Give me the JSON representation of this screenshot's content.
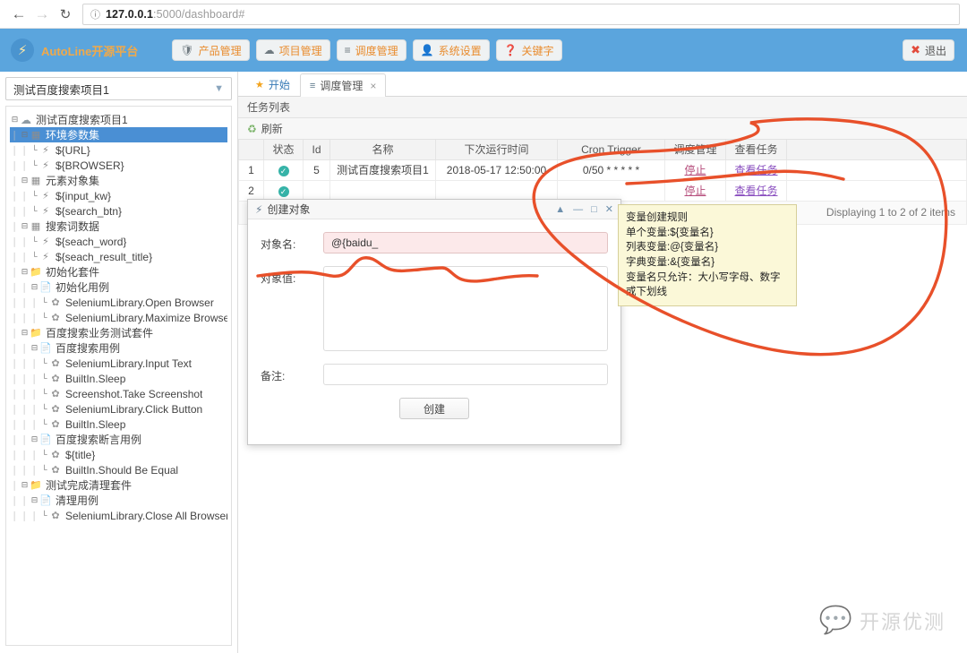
{
  "browser": {
    "back_icon": "back-arrow",
    "forward_icon": "forward-arrow",
    "reload_icon": "reload",
    "info_icon": "ⓘ",
    "url_host": "127.0.0.1",
    "url_rest": ":5000/dashboard#"
  },
  "header": {
    "brand": "AutoLine开源平台",
    "brand_color": "#f0a94a",
    "bg_color": "#5ba5dd",
    "nav": [
      {
        "label": "产品管理",
        "icon": "shield-icon"
      },
      {
        "label": "项目管理",
        "icon": "cloud-icon"
      },
      {
        "label": "调度管理",
        "icon": "list-icon"
      },
      {
        "label": "系统设置",
        "icon": "user-icon"
      },
      {
        "label": "关键字",
        "icon": "help-icon"
      }
    ],
    "logout": "退出"
  },
  "sidebar": {
    "project_selected": "测试百度搜索项目1",
    "tree": [
      {
        "depth": 0,
        "label": "测试百度搜索项目1",
        "icon": "cloud-icon",
        "expander": "minus",
        "selected": false
      },
      {
        "depth": 1,
        "label": "环境参数集",
        "icon": "folder-params-icon",
        "expander": "minus",
        "selected": true
      },
      {
        "depth": 2,
        "label": "${URL}",
        "icon": "bolt-icon",
        "expander": "leaf",
        "selected": false
      },
      {
        "depth": 2,
        "label": "${BROWSER}",
        "icon": "bolt-icon",
        "expander": "leaf",
        "selected": false
      },
      {
        "depth": 1,
        "label": "元素对象集",
        "icon": "folder-params-icon",
        "expander": "minus",
        "selected": false
      },
      {
        "depth": 2,
        "label": "${input_kw}",
        "icon": "bolt-icon",
        "expander": "leaf",
        "selected": false
      },
      {
        "depth": 2,
        "label": "${search_btn}",
        "icon": "bolt-icon",
        "expander": "leaf",
        "selected": false
      },
      {
        "depth": 1,
        "label": "搜索词数据",
        "icon": "folder-params-icon",
        "expander": "minus",
        "selected": false
      },
      {
        "depth": 2,
        "label": "${seach_word}",
        "icon": "bolt-icon",
        "expander": "leaf",
        "selected": false
      },
      {
        "depth": 2,
        "label": "${seach_result_title}",
        "icon": "bolt-icon",
        "expander": "leaf",
        "selected": false
      },
      {
        "depth": 1,
        "label": "初始化套件",
        "icon": "folder-icon",
        "expander": "minus",
        "selected": false
      },
      {
        "depth": 2,
        "label": "初始化用例",
        "icon": "file-icon",
        "expander": "minus",
        "selected": false
      },
      {
        "depth": 3,
        "label": "SeleniumLibrary.Open Browser",
        "icon": "leaf-icon",
        "expander": "leaf",
        "selected": false
      },
      {
        "depth": 3,
        "label": "SeleniumLibrary.Maximize Browser Wi",
        "icon": "leaf-icon",
        "expander": "leaf",
        "selected": false
      },
      {
        "depth": 1,
        "label": "百度搜索业务测试套件",
        "icon": "folder-icon",
        "expander": "minus",
        "selected": false
      },
      {
        "depth": 2,
        "label": "百度搜索用例",
        "icon": "file-icon",
        "expander": "minus",
        "selected": false
      },
      {
        "depth": 3,
        "label": "SeleniumLibrary.Input Text",
        "icon": "leaf-icon",
        "expander": "leaf",
        "selected": false
      },
      {
        "depth": 3,
        "label": "BuiltIn.Sleep",
        "icon": "leaf-icon",
        "expander": "leaf",
        "selected": false
      },
      {
        "depth": 3,
        "label": "Screenshot.Take Screenshot",
        "icon": "leaf-icon",
        "expander": "leaf",
        "selected": false
      },
      {
        "depth": 3,
        "label": "SeleniumLibrary.Click Button",
        "icon": "leaf-icon",
        "expander": "leaf",
        "selected": false
      },
      {
        "depth": 3,
        "label": "BuiltIn.Sleep",
        "icon": "leaf-icon",
        "expander": "leaf",
        "selected": false
      },
      {
        "depth": 2,
        "label": "百度搜索断言用例",
        "icon": "file-icon",
        "expander": "minus",
        "selected": false
      },
      {
        "depth": 3,
        "label": "${title}",
        "icon": "leaf-icon",
        "expander": "leaf",
        "selected": false
      },
      {
        "depth": 3,
        "label": "BuiltIn.Should Be Equal",
        "icon": "leaf-icon",
        "expander": "leaf",
        "selected": false
      },
      {
        "depth": 1,
        "label": "测试完成清理套件",
        "icon": "folder-icon",
        "expander": "minus",
        "selected": false
      },
      {
        "depth": 2,
        "label": "清理用例",
        "icon": "file-icon",
        "expander": "minus",
        "selected": false
      },
      {
        "depth": 3,
        "label": "SeleniumLibrary.Close All Browsers",
        "icon": "leaf-icon",
        "expander": "leaf",
        "selected": false
      }
    ]
  },
  "main": {
    "tabs": [
      {
        "label": "开始",
        "icon": "star-icon",
        "active": false,
        "closable": false
      },
      {
        "label": "调度管理",
        "icon": "list-icon",
        "active": true,
        "closable": true
      }
    ],
    "panel_title": "任务列表",
    "refresh_label": "刷新",
    "table": {
      "columns": [
        "",
        "状态",
        "Id",
        "名称",
        "下次运行时间",
        "Cron Trigger",
        "调度管理",
        "查看任务",
        ""
      ],
      "rows": [
        {
          "index": "1",
          "status_icon": "check-circle-icon",
          "id": "5",
          "name": "测试百度搜索项目1",
          "next_run": "2018-05-17 12:50:00",
          "cron": "0/50 * * * * *",
          "manage": "停止",
          "view": "查看任务"
        },
        {
          "index": "2",
          "status_icon": "check-circle-icon",
          "id": "",
          "name": "",
          "next_run": "",
          "cron": "",
          "manage": "停止",
          "view": "查看任务"
        }
      ]
    },
    "pager_text": "Displaying 1 to 2 of 2 items"
  },
  "dialog": {
    "title": "创建对象",
    "title_icon": "bolt-icon",
    "controls": [
      "collapse-icon",
      "minimize-icon",
      "maximize-icon",
      "close-icon"
    ],
    "fields": [
      {
        "label": "对象名:",
        "value": "@{baidu_",
        "type": "text",
        "invalid": true
      },
      {
        "label": "对象值:",
        "value": "",
        "type": "textarea",
        "invalid": false
      },
      {
        "label": "备注:",
        "value": "",
        "type": "text",
        "invalid": false
      }
    ],
    "submit": "创建"
  },
  "tooltip": {
    "lines": [
      "变量创建规则",
      "单个变量:${变量名}",
      "列表变量:@{变量名}",
      "字典变量:&{变量名}",
      "变量名只允许：大小写字母、数字或下划线"
    ],
    "bg_color": "#fbf8d8"
  },
  "annotation": {
    "color": "#e8502a",
    "shapes": [
      "large-oval-around-view-task-column",
      "squiggle-under-object-name-field"
    ]
  },
  "watermark": {
    "text": "开源优测",
    "icon": "wechat-icon"
  }
}
